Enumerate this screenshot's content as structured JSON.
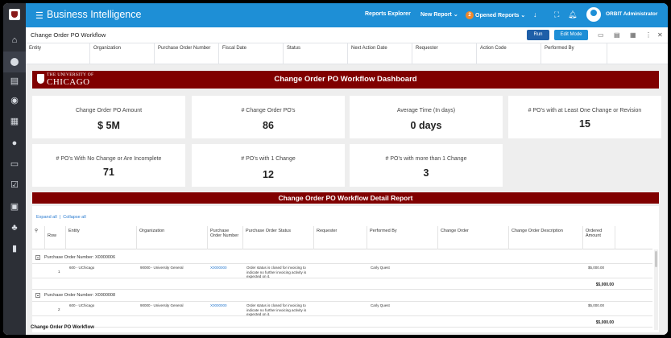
{
  "app": {
    "title": "Business Intelligence"
  },
  "topbar": {
    "reports_explorer": "Reports Explorer",
    "new_report": "New Report",
    "opened_reports": "Opened Reports",
    "opened_count": "2",
    "user_name": "ORBIT Administrator"
  },
  "report": {
    "title": "Change Order PO Workflow",
    "run_label": "Run",
    "edit_label": "Edit Mode"
  },
  "filters": [
    "Entity",
    "Organization",
    "Purchase Order Number",
    "Fiscal Date",
    "Status",
    "Next Action Date",
    "Requester",
    "Action Code",
    "Performed By"
  ],
  "banner": {
    "univ_line1": "THE UNIVERSITY OF",
    "univ_line2": "CHICAGO",
    "title": "Change Order PO Workflow Dashboard"
  },
  "cards": [
    {
      "label": "Change Order PO Amount",
      "value": "$ 5M"
    },
    {
      "label": "# Change Order PO's",
      "value": "86"
    },
    {
      "label": "Average Time (In days)",
      "value": "0 days"
    },
    {
      "label": "# PO's with at Least One Change or Revision",
      "value": "15"
    },
    {
      "label": "# PO's With No Change or Are Incomplete",
      "value": "71"
    },
    {
      "label": "# PO's with 1 Change",
      "value": "12"
    },
    {
      "label": "# PO's with more than 1 Change",
      "value": "3"
    }
  ],
  "detail": {
    "title": "Change Order PO Workflow Detail Report",
    "expand_all": "Expand all",
    "collapse_all": "Collapse all",
    "columns": [
      "Row",
      "Entity",
      "Organization",
      "Purchase Order Number",
      "Purchase Order Status",
      "Requester",
      "Performed By",
      "Change Order",
      "Change Order Description",
      "Ordered Amount"
    ],
    "groups": [
      {
        "label": "Purchase Order Number: X0000006",
        "row": {
          "num": "1",
          "entity": "600 - UChicago",
          "org": "90000 - University General",
          "po": "X0000000",
          "status": "Order status is closed for invoicing to indicate no further invoicing activity is expected on it.",
          "performed_by": "Carly Quest",
          "amount": "$5,000.00"
        },
        "subtotal": "$5,000.00"
      },
      {
        "label": "Purchase Order Number: X0000008",
        "row": {
          "num": "2",
          "entity": "600 - UChicago",
          "org": "90000 - University General",
          "po": "X0000000",
          "status": "Order status is closed for invoicing to indicate no further invoicing activity is expected on it.",
          "performed_by": "Carly Quest",
          "amount": "$5,000.00"
        },
        "subtotal": "$5,000.00"
      }
    ]
  },
  "footer": {
    "title": "Change Order PO Workflow"
  },
  "icons": {
    "nav": [
      "home-icon",
      "dashboard-icon",
      "reports-icon",
      "analytics-icon",
      "chart-icon",
      "users-icon",
      "monitor-icon",
      "tasks-icon",
      "schedule-icon",
      "groups-icon",
      "storage-icon"
    ]
  }
}
